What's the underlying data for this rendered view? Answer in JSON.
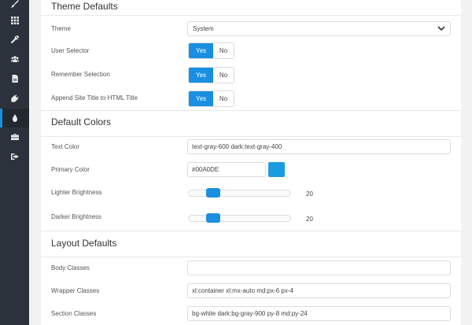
{
  "sidebar": {
    "items": [
      {
        "icon": "paintbrush-icon"
      },
      {
        "icon": "grid-icon"
      },
      {
        "icon": "wrench-icon"
      },
      {
        "icon": "users-icon"
      },
      {
        "icon": "document-icon"
      },
      {
        "icon": "plug-icon"
      },
      {
        "icon": "droplet-icon",
        "active": true
      },
      {
        "icon": "briefcase-icon"
      },
      {
        "icon": "sign-out-icon"
      }
    ],
    "accent": "#1a8fe0"
  },
  "theme_defaults": {
    "title": "Theme Defaults",
    "theme": {
      "label": "Theme",
      "value": "System"
    },
    "user_selector": {
      "label": "User Selector",
      "yes": "Yes",
      "no": "No",
      "selected": "Yes"
    },
    "remember_selection": {
      "label": "Remember Selection",
      "yes": "Yes",
      "no": "No",
      "selected": "Yes"
    },
    "append_title": {
      "label": "Append Site Title to HTML Title",
      "yes": "Yes",
      "no": "No",
      "selected": "Yes"
    }
  },
  "default_colors": {
    "title": "Default Colors",
    "text_color": {
      "label": "Text Color",
      "value": "text-gray-600 dark:text-gray-400"
    },
    "primary_color": {
      "label": "Primary Color",
      "value": "#00A0DE",
      "swatch": "#1a9be0"
    },
    "lighter_brightness": {
      "label": "Lighter Brightness",
      "value": "20",
      "level": 20
    },
    "darker_brightness": {
      "label": "Darker Brightness",
      "value": "20",
      "level": 20
    }
  },
  "layout_defaults": {
    "title": "Layout Defaults",
    "body_classes": {
      "label": "Body Classes",
      "value": ""
    },
    "wrapper_classes": {
      "label": "Wrapper Classes",
      "value": "xl:container xl:mx-auto md:px-6 px-4"
    },
    "section_classes": {
      "label": "Section Classes",
      "value": "bg-white dark:bg-gray-900 py-8 md:py-24"
    }
  }
}
